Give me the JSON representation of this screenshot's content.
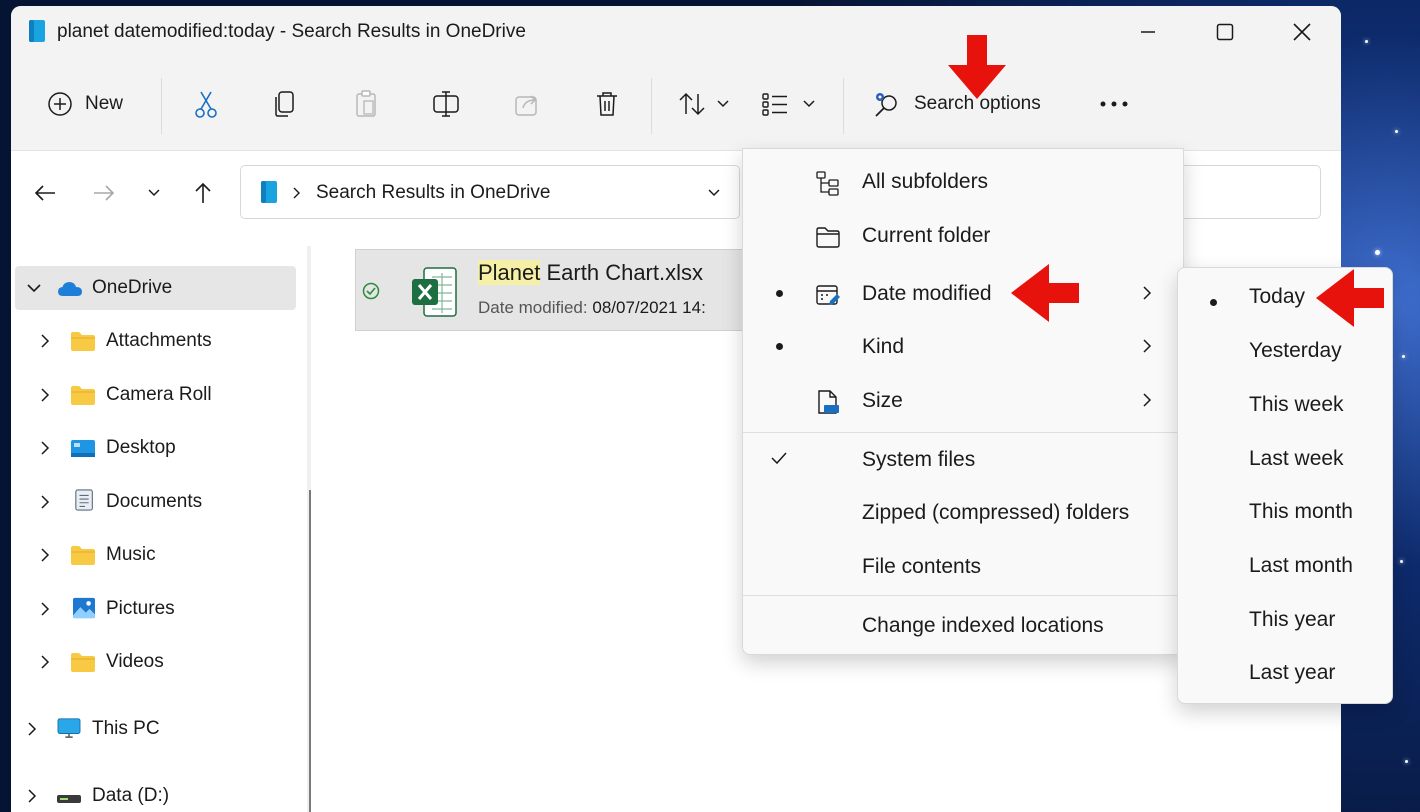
{
  "window": {
    "title": "planet datemodified:today - Search Results in OneDrive"
  },
  "toolbar": {
    "new_label": "New",
    "search_options_label": "Search options"
  },
  "address": {
    "path": "Search Results in OneDrive"
  },
  "sidebar": {
    "items": [
      {
        "label": "OneDrive",
        "icon": "onedrive-cloud-icon",
        "selected": true
      },
      {
        "label": "Attachments",
        "icon": "folder-icon"
      },
      {
        "label": "Camera Roll",
        "icon": "folder-icon"
      },
      {
        "label": "Desktop",
        "icon": "desktop-folder-icon"
      },
      {
        "label": "Documents",
        "icon": "documents-icon"
      },
      {
        "label": "Music",
        "icon": "folder-icon"
      },
      {
        "label": "Pictures",
        "icon": "pictures-icon"
      },
      {
        "label": "Videos",
        "icon": "folder-icon"
      },
      {
        "label": "This PC",
        "icon": "monitor-icon"
      },
      {
        "label": "Data (D:)",
        "icon": "drive-icon"
      }
    ]
  },
  "file": {
    "name_highlight": "Planet",
    "name_rest": " Earth Chart.xlsx",
    "meta_label": "Date modified:",
    "meta_value": "08/07/2021 14:"
  },
  "menu": {
    "items": [
      {
        "label": "All subfolders",
        "icon": "tree-icon"
      },
      {
        "label": "Current folder",
        "icon": "folder-outline-icon"
      },
      {
        "label": "Date modified",
        "icon": "calendar-edit-icon",
        "bullet": true,
        "submenu": true
      },
      {
        "label": "Kind",
        "bullet": true,
        "submenu": true
      },
      {
        "label": "Size",
        "icon": "file-size-icon",
        "submenu": true
      },
      {
        "label": "System files",
        "checked": true
      },
      {
        "label": "Zipped (compressed) folders"
      },
      {
        "label": "File contents"
      },
      {
        "label": "Change indexed locations"
      }
    ]
  },
  "submenu": {
    "items": [
      {
        "label": "Today",
        "selected": true
      },
      {
        "label": "Yesterday"
      },
      {
        "label": "This week"
      },
      {
        "label": "Last week"
      },
      {
        "label": "This month"
      },
      {
        "label": "Last month"
      },
      {
        "label": "This year"
      },
      {
        "label": "Last year"
      }
    ]
  },
  "colors": {
    "annotation_arrow": "#e8120c",
    "accent": "#0078d4",
    "folder": "#f8c942"
  }
}
